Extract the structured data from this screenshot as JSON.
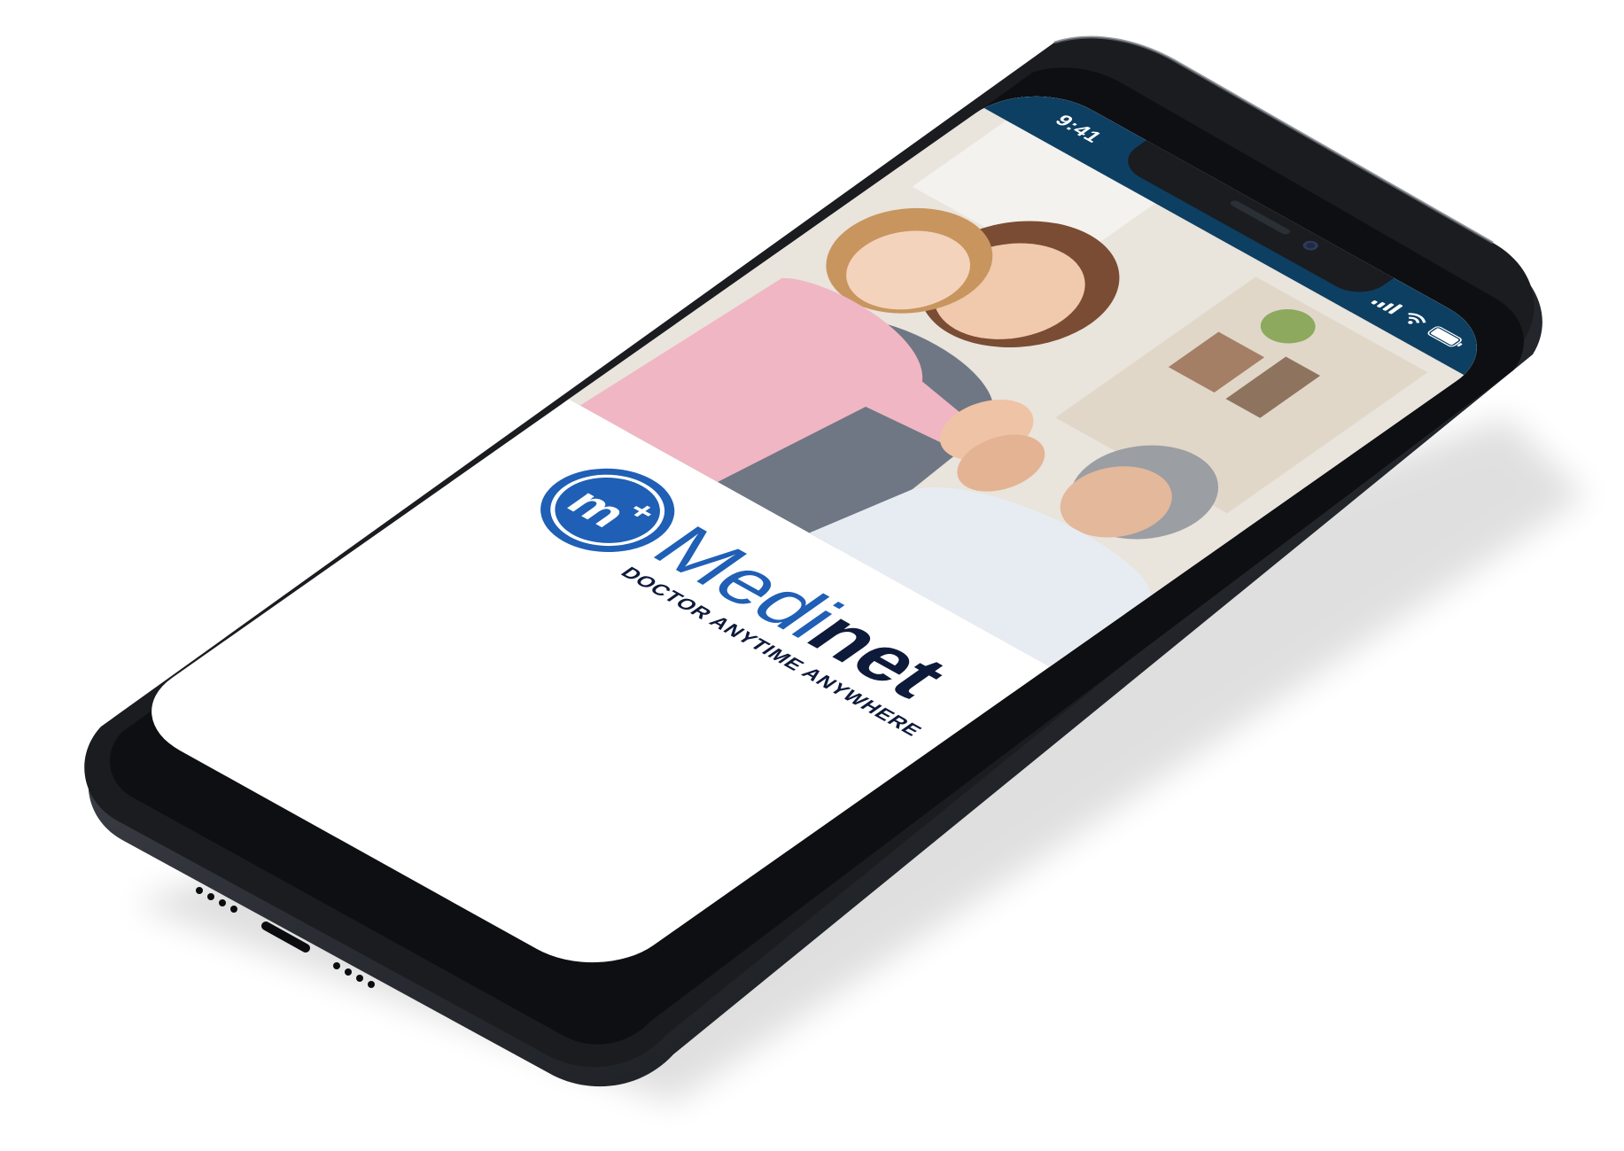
{
  "status_bar": {
    "time": "9:41",
    "background": "#0d3f62"
  },
  "icons": {
    "signal": "signal-strength-icon",
    "wifi": "wifi-icon",
    "battery": "battery-icon"
  },
  "brand": {
    "logo_mark": "m+",
    "name_part_a": "Medi",
    "name_part_b": "net",
    "tagline": "DOCTOR ANYTIME ANYWHERE",
    "primary_color": "#1f5fb5",
    "dark_color": "#0d1a3a"
  },
  "hero_image": {
    "subject": "doctor-patient-high-five-photo"
  },
  "device": {
    "frame_color": "#1a1c20"
  }
}
